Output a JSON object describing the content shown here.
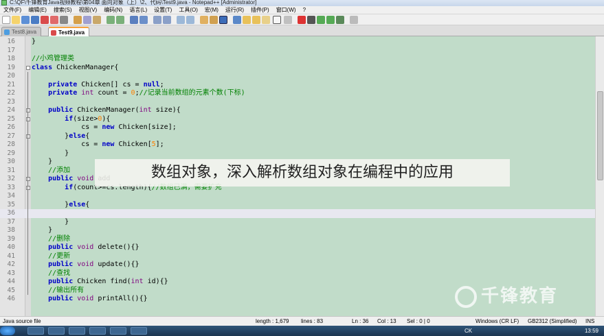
{
  "window": {
    "title": "C:\\QF\\千锋教育Java视频教程\\第04章 面向对象（上）\\2、代码\\Test9.java - Notepad++ [Administrator]"
  },
  "menu": [
    "文件(F)",
    "编辑(E)",
    "搜索(S)",
    "视图(V)",
    "编码(N)",
    "语言(L)",
    "设置(T)",
    "工具(O)",
    "宏(M)",
    "运行(R)",
    "插件(P)",
    "窗口(W)",
    "?"
  ],
  "tabs": [
    {
      "label": "Test8.java",
      "active": false
    },
    {
      "label": "Test9.java",
      "active": true
    }
  ],
  "editor": {
    "current_line": "36",
    "lines": [
      {
        "n": "16",
        "code": "}"
      },
      {
        "n": "17",
        "code": ""
      },
      {
        "n": "18",
        "code": "//小鸡管理类"
      },
      {
        "n": "19",
        "code": "class ChickenManager{"
      },
      {
        "n": "20",
        "code": ""
      },
      {
        "n": "21",
        "code": "    private Chicken[] cs = null;"
      },
      {
        "n": "22",
        "code": "    private int count = 0;//记录当前数组的元素个数(下标)"
      },
      {
        "n": "23",
        "code": ""
      },
      {
        "n": "24",
        "code": "    public ChickenManager(int size){"
      },
      {
        "n": "25",
        "code": "        if(size>0){"
      },
      {
        "n": "26",
        "code": "            cs = new Chicken[size];"
      },
      {
        "n": "27",
        "code": "        }else{"
      },
      {
        "n": "28",
        "code": "            cs = new Chicken[5];"
      },
      {
        "n": "29",
        "code": "        }"
      },
      {
        "n": "30",
        "code": "    }"
      },
      {
        "n": "31",
        "code": "    //添加"
      },
      {
        "n": "32",
        "code": "    public void add"
      },
      {
        "n": "33",
        "code": "        if(count>=cs.length){//数组已满，需要扩充"
      },
      {
        "n": "34",
        "code": ""
      },
      {
        "n": "35",
        "code": "        }else{"
      },
      {
        "n": "36",
        "code": ""
      },
      {
        "n": "37",
        "code": "        }"
      },
      {
        "n": "38",
        "code": "    }"
      },
      {
        "n": "39",
        "code": "    //删除"
      },
      {
        "n": "40",
        "code": "    public void delete(){}"
      },
      {
        "n": "41",
        "code": "    //更新"
      },
      {
        "n": "42",
        "code": "    public void update(){}"
      },
      {
        "n": "43",
        "code": "    //查找"
      },
      {
        "n": "44",
        "code": "    public Chicken find(int id){}"
      },
      {
        "n": "45",
        "code": "    //输出所有"
      },
      {
        "n": "46",
        "code": "    public void printAll(){}"
      }
    ]
  },
  "status": {
    "file_type": "Java source file",
    "length": "length : 1,679",
    "lines": "lines : 83",
    "ln": "Ln : 36",
    "col": "Col : 13",
    "sel": "Sel : 0 | 0",
    "eol": "Windows (CR LF)",
    "encoding": "GB2312 (Simplified)",
    "mode": "INS"
  },
  "taskbar": {
    "lang": "CK",
    "clock": "13:59"
  },
  "overlay": {
    "caption": "数组对象，深入解析数组对象在编程中的应用",
    "watermark": "千锋教育"
  },
  "colors": {
    "editor_bg": "#c1dcc9",
    "keyword": "#0000c8",
    "comment": "#008000",
    "number": "#ff8000",
    "type": "#7f007f",
    "active_tab_accent": "#f7a23c"
  }
}
